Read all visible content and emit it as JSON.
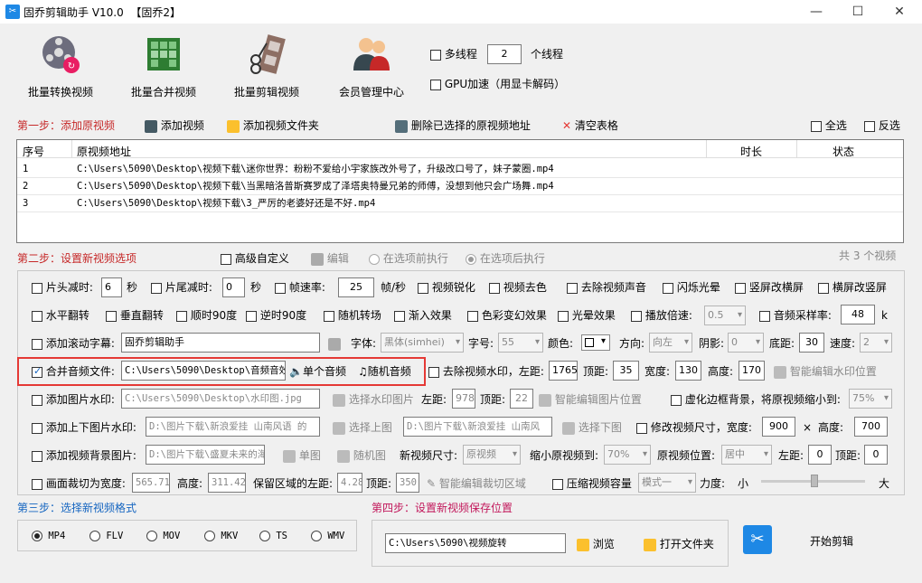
{
  "window": {
    "title": "固乔剪辑助手 V10.0  【固乔2】",
    "app_icon": "scissors-icon",
    "minimize": "—",
    "maximize": "☐",
    "close": "✕"
  },
  "toolbar": {
    "batch_convert": "批量转换视频",
    "batch_merge": "批量合并视频",
    "batch_edit": "批量剪辑视频",
    "member_center": "会员管理中心",
    "multithread_label": "多线程",
    "thread_count": "2",
    "thread_unit": "个线程",
    "gpu_label": "GPU加速（用显卡解码）"
  },
  "step1": {
    "title": "第一步：添加原视频",
    "add_video": "添加视频",
    "add_folder": "添加视频文件夹",
    "delete_selected": "删除已选择的原视频地址",
    "clear_table": "清空表格",
    "select_all": "全选",
    "invert": "反选"
  },
  "table": {
    "headers": [
      "序号",
      "原视频地址",
      "时长",
      "状态"
    ],
    "rows": [
      {
        "no": "1",
        "path": "C:\\Users\\5090\\Desktop\\视频下载\\迷你世界：粉粉不爱给小宇家族改外号了，升级改口号了，妹子蒙圈.mp4"
      },
      {
        "no": "2",
        "path": "C:\\Users\\5090\\Desktop\\视频下载\\当黑暗洛普斯赛罗成了泽塔奥特曼兄弟的师傅，没想到他只会广场舞.mp4"
      },
      {
        "no": "3",
        "path": "C:\\Users\\5090\\Desktop\\视频下载\\3_严厉的老婆好还是不好.mp4"
      }
    ]
  },
  "step2": {
    "title": "第二步：设置新视频选项",
    "advanced_custom": "高级自定义",
    "edit": "编辑",
    "before_exec": "在选项前执行",
    "after_exec": "在选项后执行",
    "total_count": "共 3 个视频"
  },
  "opts": {
    "head_cut": "片头减时:",
    "head_val": "6",
    "sec1": "秒",
    "tail_cut": "片尾减时:",
    "tail_val": "0",
    "sec2": "秒",
    "framerate": "帧速率:",
    "framerate_val": "25",
    "fps_unit": "帧/秒",
    "sharpen": "视频锐化",
    "decolor": "视频去色",
    "remove_audio": "去除视频声音",
    "flash": "闪烁光晕",
    "v2h": "竖屏改横屏",
    "h2v": "横屏改竖屏",
    "hflip": "水平翻转",
    "vflip": "垂直翻转",
    "rot90": "顺时90度",
    "rot_ccw": "逆时90度",
    "random_trans": "随机转场",
    "fade_in": "渐入效果",
    "color_mix": "色彩变幻效果",
    "halo": "光晕效果",
    "speed": "播放倍速:",
    "speed_val": "0.5",
    "sample_rate": "音频采样率:",
    "sample_val": "48",
    "sample_unit": "k",
    "scroll_sub": "添加滚动字幕:",
    "scroll_text": "固乔剪辑助手",
    "font_lbl": "字体:",
    "font_val": "黑体(simhei)",
    "size_lbl": "字号:",
    "size_val": "55",
    "color_lbl": "颜色:",
    "dir_lbl": "方向:",
    "dir_val": "向左",
    "shadow_lbl": "阴影:",
    "shadow_val": "0",
    "bottom_lbl": "底距:",
    "bottom_val": "30",
    "spd_lbl": "速度:",
    "spd_val": "2",
    "merge_audio": "合并音频文件:",
    "merge_path": "C:\\Users\\5090\\Desktop\\音频音效",
    "single_audio": "单个音频",
    "random_audio": "随机音频",
    "remove_wm": "去除视频水印，左距:",
    "wm_left": "1765",
    "wm_top_lbl": "顶距:",
    "wm_top": "35",
    "wm_w_lbl": "宽度:",
    "wm_w": "130",
    "wm_h_lbl": "高度:",
    "wm_h": "170",
    "smart_wm": "智能编辑水印位置",
    "img_wm": "添加图片水印:",
    "img_wm_path": "C:\\Users\\5090\\Desktop\\水印图.jpg",
    "select_wm_img": "选择水印图片",
    "img_left_lbl": "左距:",
    "img_left": "978",
    "img_top_lbl": "顶距:",
    "img_top": "22",
    "smart_img": "智能编辑图片位置",
    "blur_border": "虚化边框背景，将原视频缩小到:",
    "blur_val": "75%",
    "tb_wm": "添加上下图片水印:",
    "top_img_path": "D:\\图片下载\\新浪爱挂 山南风语 的",
    "select_top": "选择上图",
    "bottom_img_path": "D:\\图片下载\\新浪爱挂 山南风",
    "select_bottom": "选择下图",
    "resize": "修改视频尺寸，宽度:",
    "resize_w": "900",
    "times": "×",
    "resize_h_lbl": "高度:",
    "resize_h": "700",
    "bg_img": "添加视频背景图片:",
    "bg_path": "D:\\图片下载\\盛夏未来的海",
    "single_img": "单图",
    "random_img": "随机图",
    "new_size_lbl": "新视频尺寸:",
    "new_size_val": "原视频",
    "shrink_lbl": "缩小原视频到:",
    "shrink_val": "70%",
    "pos_lbl": "原视频位置:",
    "pos_val": "居中",
    "bg_left_lbl": "左距:",
    "bg_left": "0",
    "bg_top_lbl": "顶距:",
    "bg_top": "0",
    "crop": "画面裁切为宽度:",
    "crop_w": "565.714",
    "crop_h_lbl": "高度:",
    "crop_h": "311.428",
    "keep_left_lbl": "保留区域的左距:",
    "keep_left": "4.28",
    "keep_top_lbl": "顶距:",
    "keep_top": "350",
    "smart_crop": "智能编辑裁切区域",
    "compress": "压缩视频容量",
    "compress_mode": "模式一",
    "strength_lbl": "力度:",
    "small": "小",
    "large": "大"
  },
  "step3": {
    "title": "第三步：选择新视频格式",
    "formats": [
      "MP4",
      "FLV",
      "MOV",
      "MKV",
      "TS",
      "WMV"
    ]
  },
  "step4": {
    "title": "第四步：设置新视频保存位置",
    "save_path": "C:\\Users\\5090\\视频旋转",
    "browse": "浏览",
    "open_folder": "打开文件夹"
  },
  "start": {
    "label": "开始剪辑"
  }
}
